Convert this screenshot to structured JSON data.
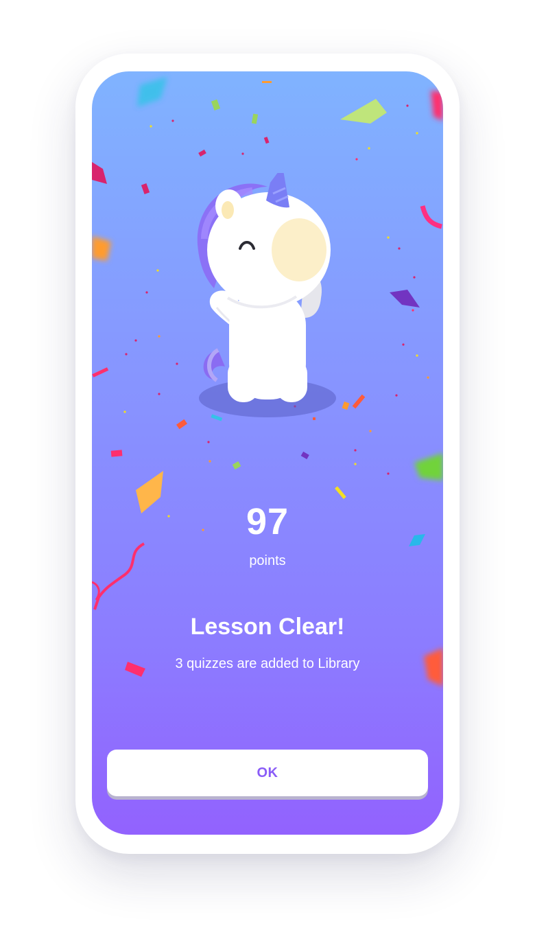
{
  "result": {
    "score": "97",
    "score_unit": "points",
    "title": "Lesson Clear!",
    "message": "3 quizzes are added to Library"
  },
  "actions": {
    "ok_label": "OK"
  },
  "theme": {
    "gradient_top": "#80b3ff",
    "gradient_bottom": "#9262fe",
    "button_text": "#8a5cf7"
  },
  "illustration": {
    "mascot": "unicorn-icon",
    "decoration": "confetti"
  }
}
